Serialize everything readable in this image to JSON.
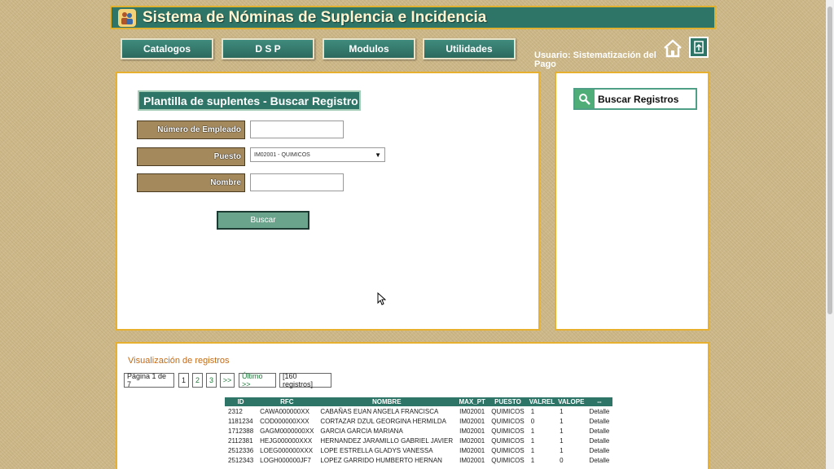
{
  "header": {
    "title": "Sistema de Nóminas de Suplencia e Incidencia"
  },
  "nav": {
    "items": [
      "Catalogos",
      "D S P",
      "Modulos",
      "Utilidades"
    ]
  },
  "user": {
    "label": "Usuario: Sistematización del Pago"
  },
  "form": {
    "title": "Plantilla de suplentes - Buscar Registro",
    "empleado_label": "Número de Empleado",
    "empleado_value": "",
    "puesto_label": "Puesto",
    "puesto_selected": "IM02001 - QUIMICOS",
    "nombre_label": "Nombre",
    "nombre_value": "",
    "buscar_label": "Buscar"
  },
  "side": {
    "search_label": "Buscar Registros"
  },
  "results": {
    "title": "Visualización de registros",
    "page_info": "Página 1 de 7",
    "pages": [
      "1",
      "2",
      "3"
    ],
    "next": ">>",
    "last": "Último >>",
    "count": "[160 registros]",
    "columns": [
      "ID",
      "RFC",
      "NOMBRE",
      "MAX_PT",
      "PUESTO",
      "VALREL",
      "VALOPE",
      "--"
    ],
    "rows": [
      [
        "2312",
        "CAWA000000XX",
        "CABAÑAS EUAN ANGELA FRANCISCA",
        "IM02001",
        "QUIMICOS",
        "1",
        "1",
        "Detalle"
      ],
      [
        "1181234",
        "COD000000XXX",
        "CORTAZAR DZUL GEORGINA HERMILDA",
        "IM02001",
        "QUIMICOS",
        "0",
        "1",
        "Detalle"
      ],
      [
        "1712388",
        "GAGM0000000XX",
        "GARCIA GARCIA MARIANA",
        "IM02001",
        "QUIMICOS",
        "1",
        "1",
        "Detalle"
      ],
      [
        "2112381",
        "HEJG000000XXX",
        "HERNANDEZ JARAMILLO GABRIEL JAVIER",
        "IM02001",
        "QUIMICOS",
        "1",
        "1",
        "Detalle"
      ],
      [
        "2512336",
        "LOEG000000XXX",
        "LOPE ESTRELLA GLADYS VANESSA",
        "IM02001",
        "QUIMICOS",
        "1",
        "1",
        "Detalle"
      ],
      [
        "2512343",
        "LOGH000000JF7",
        "LOPEZ GARRIDO HUMBERTO HERNAN",
        "IM02001",
        "QUIMICOS",
        "1",
        "0",
        "Detalle"
      ]
    ]
  }
}
